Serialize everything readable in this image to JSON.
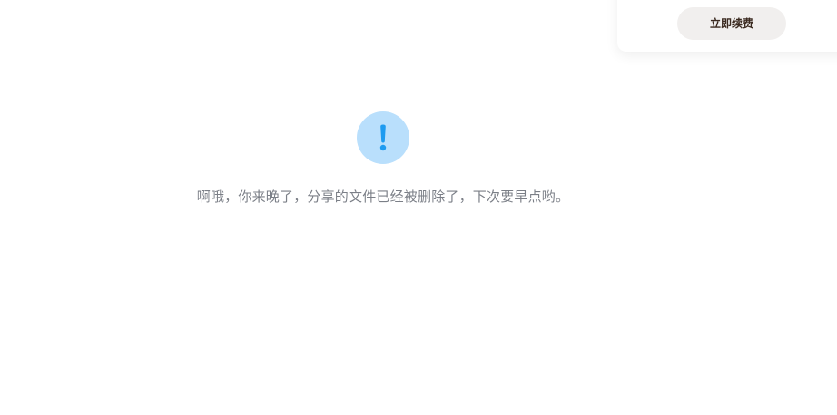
{
  "popup": {
    "renew_button_label": "立即续费"
  },
  "error_state": {
    "icon": "exclamation-icon",
    "icon_color": "#1e9bf0",
    "icon_bg": "#b9dffc",
    "message": "啊哦，你来晚了，分享的文件已经被删除了，下次要早点哟。"
  }
}
